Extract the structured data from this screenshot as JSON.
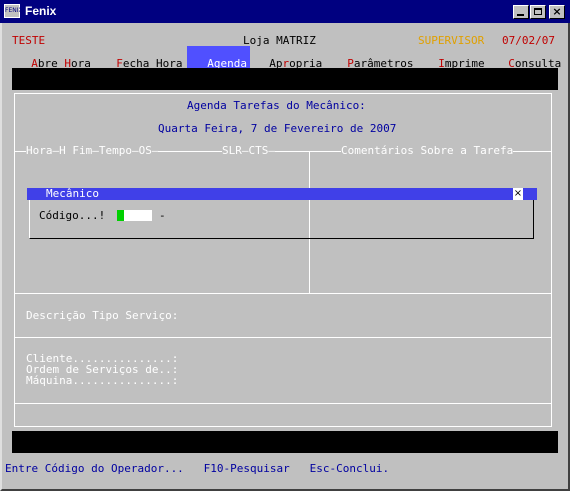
{
  "window": {
    "title": "Fenix",
    "icon": "fenix-app-icon",
    "icon_text": "FENIX"
  },
  "status_line": {
    "company": "TESTE",
    "store": "Loja MATRIZ",
    "user_role": "SUPERVISOR",
    "date": "07/02/07"
  },
  "menu": [
    {
      "pre": "",
      "hot": "A",
      "post": "bre ",
      "hot2": "H",
      "post2": "ora"
    },
    {
      "pre": "",
      "hot": "F",
      "post": "echa Hora",
      "hot2": "",
      "post2": ""
    },
    {
      "pre": "",
      "hot": "A",
      "post": "genda",
      "hot2": "",
      "post2": ""
    },
    {
      "pre": "Ap",
      "hot": "r",
      "post": "opria",
      "hot2": "",
      "post2": ""
    },
    {
      "pre": "",
      "hot": "P",
      "post": "arâmetros",
      "hot2": "",
      "post2": ""
    },
    {
      "pre": "",
      "hot": "I",
      "post": "mprime",
      "hot2": "",
      "post2": ""
    },
    {
      "pre": "",
      "hot": "C",
      "post": "onsulta",
      "hot2": "",
      "post2": ""
    }
  ],
  "agenda": {
    "title": "Agenda Tarefas do Mecânico:",
    "date_line": "Quarta Feira, 7 de Fevereiro de 2007",
    "columns_left": "Hora—H Fim—Tempo—OS—",
    "columns_mid": "SLR—CTS—",
    "columns_right": "Comentários Sobre a Tarefa"
  },
  "dialog": {
    "title": "Mecânico",
    "field_label": "Código...!",
    "field_value": "",
    "field_suffix": "-"
  },
  "details": {
    "service_type_label": "Descrição Tipo Serviço:",
    "client_label": "Cliente...............:",
    "order_label": "Ordem de Serviços de..:",
    "machine_label": "Máquina...............:"
  },
  "footer": {
    "hint": "Entre Código do Operador...   F10-Pesquisar   Esc-Conclui."
  },
  "colors": {
    "title_bar": "#000080",
    "menu_highlight": "#5050ff",
    "text_blue": "#0000a0",
    "text_red": "#c00000",
    "text_orange": "#e0a000",
    "cursor": "#00d000"
  }
}
